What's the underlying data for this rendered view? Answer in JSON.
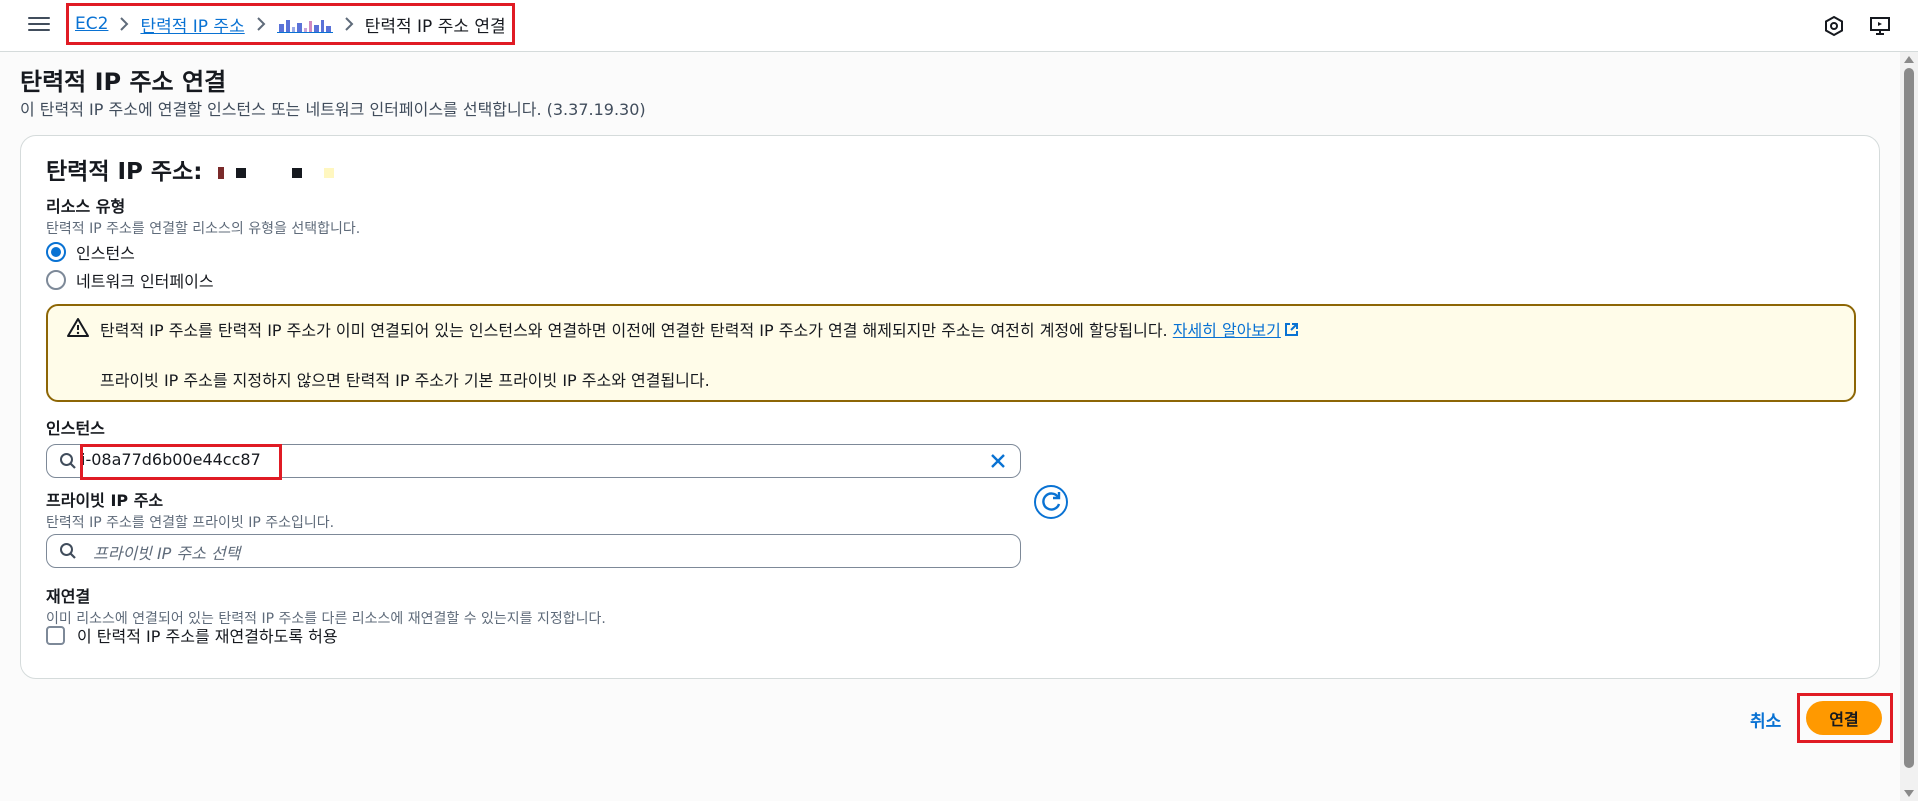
{
  "breadcrumb": {
    "ec2": "EC2",
    "eip": "탄력적 IP 주소",
    "current": "탄력적 IP 주소 연결"
  },
  "page": {
    "title": "탄력적 IP 주소 연결",
    "description": "이 탄력적 IP 주소에 연결할 인스턴스 또는 네트워크 인터페이스를 선택합니다. (3.37.19.30)"
  },
  "card": {
    "title_prefix": "탄력적 IP 주소: "
  },
  "resource_type": {
    "label": "리소스 유형",
    "description": "탄력적 IP 주소를 연결할 리소스의 유형을 선택합니다.",
    "options": [
      {
        "label": "인스턴스",
        "selected": true
      },
      {
        "label": "네트워크 인터페이스",
        "selected": false
      }
    ]
  },
  "alert": {
    "line1": "탄력적 IP 주소를 탄력적 IP 주소가 이미 연결되어 있는 인스턴스와 연결하면 이전에 연결한 탄력적 IP 주소가 연결 해제되지만 주소는 여전히 계정에 할당됩니다. ",
    "link": "자세히 알아보기",
    "line2": "프라이빗 IP 주소를 지정하지 않으면 탄력적 IP 주소가 기본 프라이빗 IP 주소와 연결됩니다."
  },
  "instance": {
    "label": "인스턴스",
    "value": "i-08a77d6b00e44cc87"
  },
  "private_ip": {
    "label": "프라이빗 IP 주소",
    "description": "탄력적 IP 주소를 연결할 프라이빗 IP 주소입니다.",
    "placeholder": "프라이빗 IP 주소 선택"
  },
  "reassociate": {
    "label": "재연결",
    "description": "이미 리소스에 연결되어 있는 탄력적 IP 주소를 다른 리소스에 재연결할 수 있는지를 지정합니다.",
    "checkbox_label": "이 탄력적 IP 주소를 재연결하도록 허용",
    "checked": false
  },
  "actions": {
    "cancel": "취소",
    "connect": "연결"
  },
  "colors": {
    "link": "#0972d3",
    "primary": "#ff9900",
    "highlight": "#e01b24",
    "warning_bg": "#fffce9",
    "warning_border": "#8d6605"
  }
}
